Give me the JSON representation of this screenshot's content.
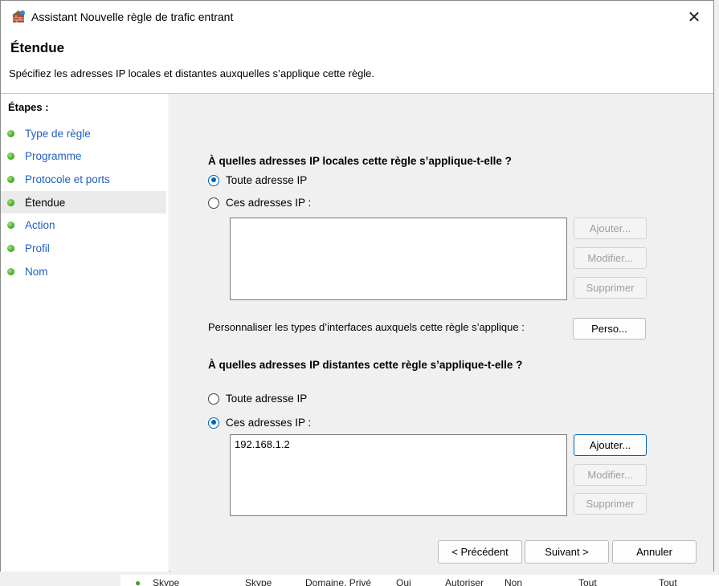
{
  "window": {
    "title": "Assistant Nouvelle règle de trafic entrant",
    "close_symbol": "✕"
  },
  "header": {
    "title": "Étendue",
    "subtitle": "Spécifiez les adresses IP locales et distantes auxquelles s’applique cette règle."
  },
  "sidebar": {
    "title": "Étapes :",
    "items": [
      {
        "label": "Type de règle",
        "current": false
      },
      {
        "label": "Programme",
        "current": false
      },
      {
        "label": "Protocole et ports",
        "current": false
      },
      {
        "label": "Étendue",
        "current": true
      },
      {
        "label": "Action",
        "current": false
      },
      {
        "label": "Profil",
        "current": false
      },
      {
        "label": "Nom",
        "current": false
      }
    ]
  },
  "local": {
    "question": "À quelles adresses IP locales cette règle s’applique-t-elle ?",
    "option_any": "Toute adresse IP",
    "option_these": "Ces adresses IP :",
    "selected": "any",
    "addresses": [],
    "add_label": "Ajouter...",
    "edit_label": "Modifier...",
    "remove_label": "Supprimer"
  },
  "interfaces": {
    "text": "Personnaliser les types d’interfaces auxquels cette règle s’applique :",
    "button_label": "Perso..."
  },
  "remote": {
    "question": "À quelles adresses IP distantes cette règle s’applique-t-elle ?",
    "option_any": "Toute adresse IP",
    "option_these": "Ces adresses IP :",
    "selected": "these",
    "addresses": [
      "192.168.1.2"
    ],
    "add_label": "Ajouter...",
    "edit_label": "Modifier...",
    "remove_label": "Supprimer"
  },
  "footer": {
    "back_label": "< Précédent",
    "next_label": "Suivant >",
    "cancel_label": "Annuler"
  },
  "background_app": {
    "cells": [
      "Skype",
      "Skype",
      "Domaine, Privé",
      "Oui",
      "Autoriser",
      "Non",
      "Tout",
      "Tout"
    ]
  },
  "colors": {
    "accent": "#0063b1",
    "link": "#1f5fbf",
    "step_done": "#3da322"
  }
}
